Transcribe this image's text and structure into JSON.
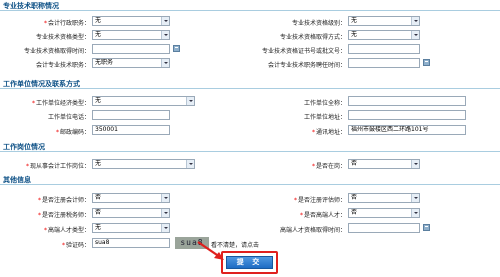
{
  "sections": {
    "tech_title": "专业技术职称情况",
    "work_title": "工作单位情况及联系方式",
    "post_title": "工作岗位情况",
    "other_title": "其他信息"
  },
  "tech": {
    "accounting_title_label": "会计行政职务：",
    "accounting_title_value": "无",
    "tech_level_label": "专业技术资格级别：",
    "tech_level_value": "无",
    "tech_type_label": "专业技术资格类型：",
    "tech_type_value": "无",
    "tech_method_label": "专业技术资格取得方式：",
    "tech_method_value": "无",
    "tech_date_label": "专业技术资格取得时间：",
    "tech_date_value": "",
    "cert_no_label": "专业技术资格证书号或批文号：",
    "cert_no_value": "",
    "post_title_label": "会计专业技术职务：",
    "post_title_value": "无职务",
    "appoint_date_label": "会计专业技术职务聘任时间：",
    "appoint_date_value": ""
  },
  "work": {
    "unit_type_label": "工作单位经济类型：",
    "unit_type_value": "无",
    "unit_name_label": "工作单位全称：",
    "unit_name_value": "",
    "unit_phone_label": "工作单位电话：",
    "unit_phone_value": "",
    "unit_addr_label": "工作单位地址：",
    "unit_addr_value": "",
    "postcode_label": "邮政编码：",
    "postcode_value": "350001",
    "mail_addr_label": "通讯地址：",
    "mail_addr_value": "福州市鼓楼区西二环路101号"
  },
  "post": {
    "current_post_label": "现从事会计工作岗位：",
    "current_post_value": "无",
    "on_duty_label": "是否在岗：",
    "on_duty_value": "否"
  },
  "other": {
    "cpa_label": "是否注册会计师：",
    "cpa_value": "否",
    "assessor_label": "是否注册评估师：",
    "assessor_value": "否",
    "tax_label": "是否注册税务师：",
    "tax_value": "否",
    "leader_label": "是否高端人才：",
    "leader_value": "否",
    "talent_type_label": "高端人才类型：",
    "talent_type_value": "无",
    "talent_date_label": "高端人才资格取得时间：",
    "talent_date_value": "",
    "captcha_label": "验证码：",
    "captcha_value": "sua8",
    "captcha_image_text": "sua8",
    "captcha_hint": "看不清楚，请点击"
  },
  "submit_label": "提 交",
  "colors": {
    "section_title": "#0b4f85",
    "required": "#e00000",
    "highlight": "#e0201e",
    "button": "#1e6cc4"
  }
}
